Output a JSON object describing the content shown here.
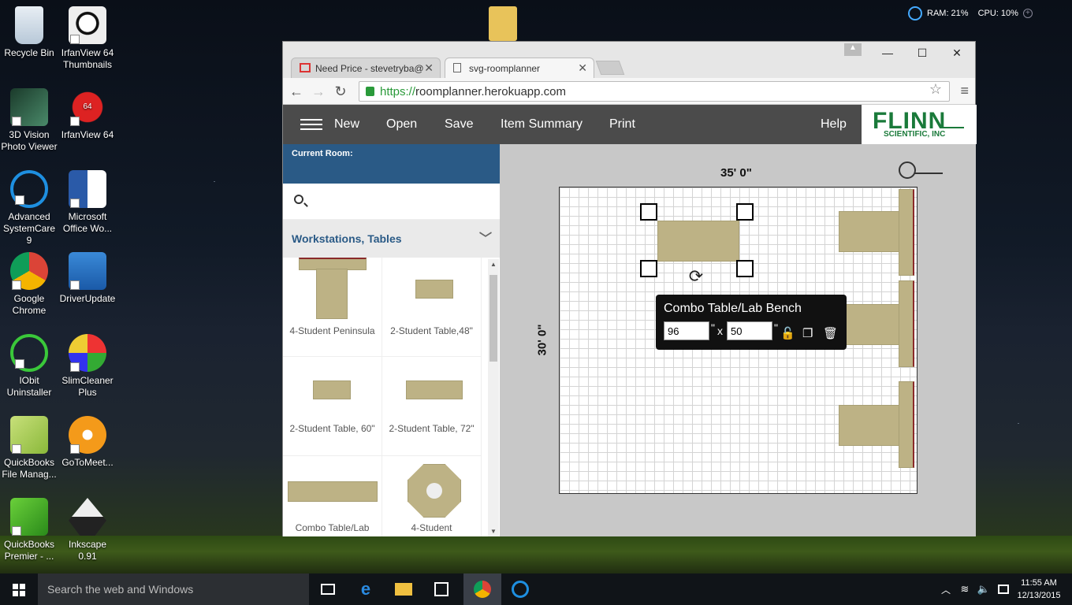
{
  "desktop": {
    "icons": [
      {
        "label": "Recycle Bin"
      },
      {
        "label": "IrfanView 64 Thumbnails"
      },
      {
        "label": "3D Vision Photo Viewer"
      },
      {
        "label": "IrfanView 64"
      },
      {
        "label": "Advanced SystemCare 9"
      },
      {
        "label": "Microsoft Office Wo..."
      },
      {
        "label": "Google Chrome"
      },
      {
        "label": "DriverUpdate"
      },
      {
        "label": "IObit Uninstaller"
      },
      {
        "label": "SlimCleaner Plus"
      },
      {
        "label": "QuickBooks File Manag..."
      },
      {
        "label": "GoToMeet..."
      },
      {
        "label": "QuickBooks Premier - ..."
      },
      {
        "label": "Inkscape 0.91"
      }
    ],
    "gadget": {
      "ram": "RAM: 21%",
      "cpu": "CPU: 10%"
    },
    "irfan_badge": "64"
  },
  "browser": {
    "tabs": [
      {
        "title": "Need Price - stevetryba@"
      },
      {
        "title": "svg-roomplanner"
      }
    ],
    "url_scheme": "https://",
    "url_host": "roomplanner.herokuapp.com"
  },
  "app": {
    "menu": {
      "new": "New",
      "open": "Open",
      "save": "Save",
      "item_summary": "Item Summary",
      "print": "Print",
      "help": "Help"
    },
    "logo": {
      "main": "FLINN",
      "sub": "SCIENTIFIC, INC"
    },
    "sidebar": {
      "current_room_label": "Current Room:",
      "category": "Workstations, Tables",
      "items": [
        {
          "label": "4-Student Peninsula"
        },
        {
          "label": "2-Student Table,48\""
        },
        {
          "label": "2-Student Table, 60\""
        },
        {
          "label": "2-Student Table, 72\""
        },
        {
          "label": "Combo Table/Lab"
        },
        {
          "label": "4-Student"
        }
      ]
    },
    "canvas": {
      "width_label": "35' 0\"",
      "height_label": "30' 0\"",
      "popup": {
        "title": "Combo Table/Lab Bench",
        "width_value": "96",
        "height_value": "50",
        "x_sep": "x",
        "inch": "\""
      }
    }
  },
  "taskbar": {
    "search_placeholder": "Search the web and Windows",
    "time": "11:55 AM",
    "date": "12/13/2015"
  }
}
